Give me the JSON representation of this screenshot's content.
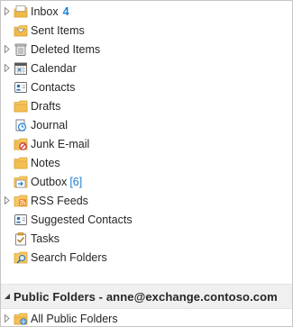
{
  "folders": [
    {
      "label": "Inbox",
      "count": "4"
    },
    {
      "label": "Sent Items"
    },
    {
      "label": "Deleted Items"
    },
    {
      "label": "Calendar"
    },
    {
      "label": "Contacts"
    },
    {
      "label": "Drafts"
    },
    {
      "label": "Journal"
    },
    {
      "label": "Junk E-mail"
    },
    {
      "label": "Notes"
    },
    {
      "label": "Outbox",
      "count": "[6]"
    },
    {
      "label": "RSS Feeds"
    },
    {
      "label": "Suggested Contacts"
    },
    {
      "label": "Tasks"
    },
    {
      "label": "Search Folders"
    }
  ],
  "public_folders": {
    "title": "Public Folders - anne@exchange.contoso.com",
    "items": [
      {
        "label": "All Public Folders"
      }
    ]
  },
  "colors": {
    "accent": "#1e7fd3",
    "folder": "#f6c760",
    "section_bg": "#f0f0f0"
  }
}
